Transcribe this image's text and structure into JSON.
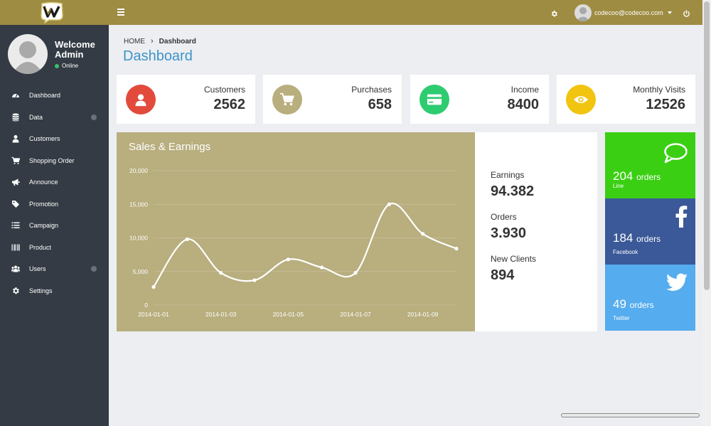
{
  "header": {
    "user_email": "codecoo@codecoo.com"
  },
  "sidebar": {
    "welcome": "Welcome",
    "user_name": "Admin",
    "status": "Online",
    "items": [
      {
        "label": "Dashboard",
        "icon": "dashboard-icon"
      },
      {
        "label": "Data",
        "icon": "database-icon",
        "has_arrow": true
      },
      {
        "label": "Customers",
        "icon": "user-icon"
      },
      {
        "label": "Shopping Order",
        "icon": "cart-icon"
      },
      {
        "label": "Announce",
        "icon": "megaphone-icon"
      },
      {
        "label": "Promotion",
        "icon": "tags-icon"
      },
      {
        "label": "Campaign",
        "icon": "list-icon"
      },
      {
        "label": "Product",
        "icon": "barcode-icon"
      },
      {
        "label": "Users",
        "icon": "users-icon",
        "has_arrow": true
      },
      {
        "label": "Settings",
        "icon": "gear-icon"
      }
    ]
  },
  "breadcrumb": {
    "home": "HOME",
    "current": "Dashboard"
  },
  "page_title": "Dashboard",
  "stats": [
    {
      "label": "Customers",
      "value": "2562",
      "color": "#e24b3c",
      "icon": "user-icon"
    },
    {
      "label": "Purchases",
      "value": "658",
      "color": "#b8ae7e",
      "icon": "cart-icon"
    },
    {
      "label": "Income",
      "value": "8400",
      "color": "#2ecc71",
      "icon": "credit-card-icon"
    },
    {
      "label": "Monthly Visits",
      "value": "12526",
      "color": "#f1c40f",
      "icon": "eye-icon"
    }
  ],
  "chart_panel_title": "Sales & Earnings",
  "chart_data": {
    "type": "line",
    "title": "Sales & Earnings",
    "x": [
      "2014-01-01",
      "2014-01-02",
      "2014-01-03",
      "2014-01-04",
      "2014-01-05",
      "2014-01-06",
      "2014-01-07",
      "2014-01-08",
      "2014-01-09",
      "2014-01-10"
    ],
    "x_tick_labels": [
      "2014-01-01",
      "2014-01-03",
      "2014-01-05",
      "2014-01-07",
      "2014-01-09"
    ],
    "y_tick_labels": [
      "20,000",
      "15,000",
      "10,000",
      "5,000",
      "0"
    ],
    "series": [
      {
        "values": [
          2700,
          9800,
          4800,
          3700,
          6800,
          5600,
          4800,
          15000,
          10600,
          8400
        ]
      }
    ],
    "ylim": [
      0,
      20000
    ],
    "grid": true,
    "colors": {
      "background": "#b8ae7e",
      "line": "#ffffff"
    }
  },
  "summary": [
    {
      "label": "Earnings",
      "value": "94.382"
    },
    {
      "label": "Orders",
      "value": "3.930"
    },
    {
      "label": "New Clients",
      "value": "894"
    }
  ],
  "social": [
    {
      "count": "204",
      "unit": "orders",
      "name": "Line",
      "color": "#3bcf14",
      "icon": "chat-icon"
    },
    {
      "count": "184",
      "unit": "orders",
      "name": "Facebook",
      "color": "#3b5998",
      "icon": "facebook-icon"
    },
    {
      "count": "49",
      "unit": "orders",
      "name": "Twitter",
      "color": "#55acee",
      "icon": "twitter-icon"
    }
  ]
}
